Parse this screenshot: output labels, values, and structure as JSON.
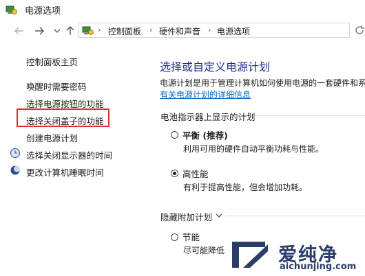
{
  "window": {
    "title": "电源选项"
  },
  "address": {
    "crumbs": [
      "控制面板",
      "硬件和声音",
      "电源选项"
    ]
  },
  "sidebar": {
    "items": [
      {
        "label": "控制面板主页"
      },
      {
        "label": "唤醒时需要密码"
      },
      {
        "label": "选择电源按钮的功能"
      },
      {
        "label": "选择关闭盖子的功能"
      },
      {
        "label": "创建电源计划"
      },
      {
        "label": "选择关闭显示器的时间"
      },
      {
        "label": "更改计算机睡眠时间"
      }
    ]
  },
  "main": {
    "heading": "选择或自定义电源计划",
    "description": "电源计划是用于管理计算机如何使用电源的一套硬件和系",
    "link": "有关电源计划的详细信息",
    "battery_section": "电池指示器上显示的计划",
    "plans": [
      {
        "name": "平衡 (推荐)",
        "desc": "利用可用的硬件自动平衡功耗与性能。",
        "selected": false
      },
      {
        "name": "高性能",
        "desc": "有利于提高性能，但会增加功耗。",
        "selected": true
      }
    ],
    "hidden_section": "隐藏附加计划",
    "hidden_plans": [
      {
        "name": "节能",
        "desc": "尽可能降低",
        "selected": false
      }
    ]
  },
  "watermark": {
    "brand": "爱纯净",
    "url": "aichunjing.com"
  },
  "colors": {
    "accent_heading": "#1e3287",
    "link": "#0a66c2",
    "highlight": "#e0322d"
  }
}
